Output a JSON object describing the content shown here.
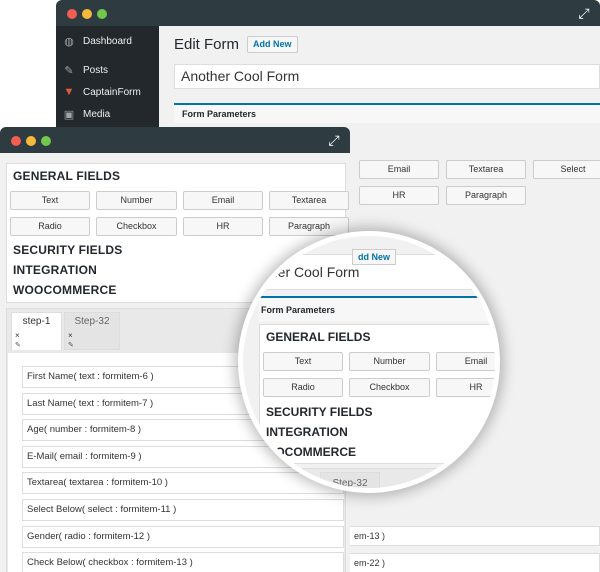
{
  "sidebar": {
    "items": [
      {
        "label": "Dashboard",
        "icon": "dashboard-icon"
      },
      {
        "label": "Posts",
        "icon": "pin-icon"
      },
      {
        "label": "CaptainForm",
        "icon": "captainform-icon"
      },
      {
        "label": "Media",
        "icon": "media-icon"
      }
    ]
  },
  "edit": {
    "title": "Edit Form",
    "add_new": "Add New",
    "form_title": "Another Cool Form",
    "params_label": "Form Parameters"
  },
  "general": {
    "title": "GENERAL FIELDS",
    "row1": [
      "Text",
      "Number",
      "Email",
      "Textarea",
      "Select"
    ],
    "row2": [
      "Radio",
      "Checkbox",
      "HR",
      "Paragraph"
    ]
  },
  "sections": [
    "SECURITY FIELDS",
    "INTEGRATION",
    "WOOCOMMERCE"
  ],
  "tabs": [
    {
      "label": "step-1",
      "close": "×",
      "edit": "✎"
    },
    {
      "label": "Step-32",
      "close": "×",
      "edit": "✎"
    }
  ],
  "fields": [
    "First Name( text : formitem-6 )",
    "Last Name( text : formitem-7 )",
    "Age( number : formitem-8 )",
    "E-Mail( email : formitem-9 )",
    "Textarea( textarea : formitem-10 )",
    "Select Below( select : formitem-11 )",
    "Gender( radio : formitem-12 )",
    "Check Below( checkbox : formitem-13 )"
  ],
  "back_fields": [
    "em-13 )",
    "em-22 )"
  ],
  "magnifier": {
    "form_title_part": "ther Cool Form",
    "add_new_part": "dd New",
    "wooc_part": "OOCOMMERCE",
    "tab_part": "Step-32"
  },
  "colors": {
    "titlebar": "#2e3b40",
    "sidebar": "#23282d",
    "accent": "#0073aa"
  }
}
